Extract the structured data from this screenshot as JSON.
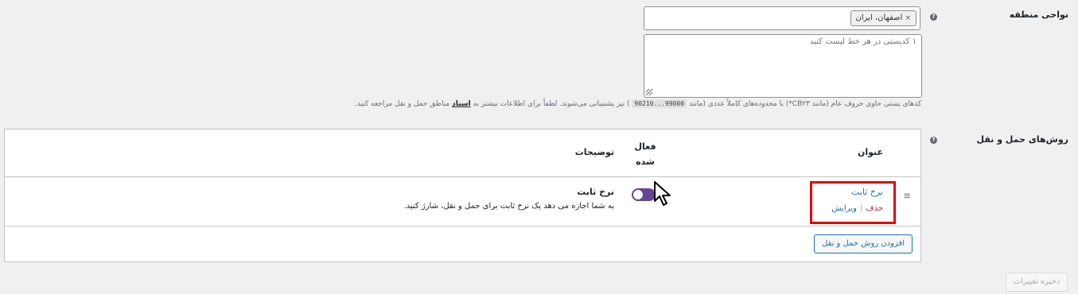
{
  "zone_regions": {
    "label": "نواحی منطقه",
    "selected_region": "اصفهان، ایران",
    "postcodes_placeholder": "۱ کدپستی در هر خط لیست کنید",
    "description_before": "کدهای پستی حاوی حروف عام (مانند CB۲۳*) یا محدوده‌های کاملاً عددی (مانند",
    "description_code": "90210...99000",
    "description_middle": ") نیز پشتیبانی می‌شوند. لطفاً برای اطلاعات بیشتر به",
    "description_link": "اسناد",
    "description_after": "مناطق حمل و نقل مراجعه کنید."
  },
  "shipping_methods": {
    "label": "روش‌های حمل و نقل",
    "columns": {
      "title": "عنوان",
      "enabled": "فعال شده",
      "description": "توضیحات"
    },
    "methods": [
      {
        "title": "نرخ ثابت",
        "edit": "ویرایش",
        "separator": "|",
        "delete": "حذف",
        "enabled": true,
        "description_title": "نرخ ثابت",
        "description_text": "به شما اجازه می دهد یک نرخ ثابت برای حمل و نقل، شارژ کنید."
      }
    ],
    "add_button": "افزودن روش حمل و نقل"
  },
  "save_button": "ذخیره تغییرات",
  "colors": {
    "accent": "#2271b1",
    "toggle": "#674399",
    "delete": "#b32d2e",
    "highlight": "#e5000a"
  }
}
